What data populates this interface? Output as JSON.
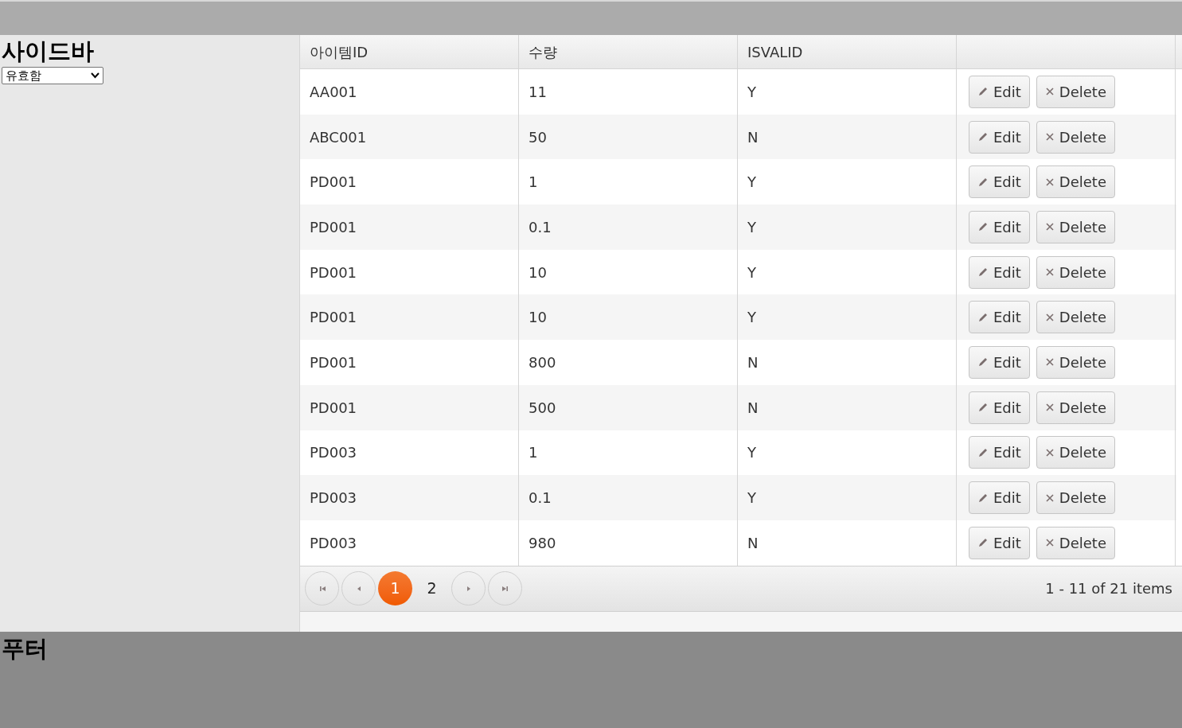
{
  "sidebar": {
    "title": "사이드바",
    "filter": {
      "value": "유효함"
    }
  },
  "grid": {
    "columns": [
      "아이템ID",
      "수량",
      "ISVALID"
    ],
    "rows": [
      {
        "cells": [
          "AA001",
          "11",
          "Y"
        ],
        "actions": [
          {
            "kind": "edit",
            "label": "Edit"
          },
          {
            "kind": "delete",
            "label": "Delete"
          }
        ]
      },
      {
        "cells": [
          "ABC001",
          "50",
          "N"
        ],
        "actions": [
          {
            "kind": "edit",
            "label": "Edit"
          },
          {
            "kind": "delete",
            "label": "Delete"
          }
        ]
      },
      {
        "cells": [
          "PD001",
          "1",
          "Y"
        ],
        "actions": [
          {
            "kind": "edit",
            "label": "Edit"
          },
          {
            "kind": "delete",
            "label": "Delete"
          }
        ]
      },
      {
        "cells": [
          "PD001",
          "0.1",
          "Y"
        ],
        "actions": [
          {
            "kind": "edit",
            "label": "Edit"
          },
          {
            "kind": "delete",
            "label": "Delete"
          }
        ]
      },
      {
        "cells": [
          "PD001",
          "10",
          "Y"
        ],
        "actions": [
          {
            "kind": "edit",
            "label": "Edit"
          },
          {
            "kind": "delete",
            "label": "Delete"
          }
        ]
      },
      {
        "cells": [
          "PD001",
          "10",
          "Y"
        ],
        "actions": [
          {
            "kind": "edit",
            "label": "Edit"
          },
          {
            "kind": "delete",
            "label": "Delete"
          }
        ]
      },
      {
        "cells": [
          "PD001",
          "800",
          "N"
        ],
        "actions": [
          {
            "kind": "edit",
            "label": "Edit"
          },
          {
            "kind": "delete",
            "label": "Delete"
          }
        ]
      },
      {
        "cells": [
          "PD001",
          "500",
          "N"
        ],
        "actions": [
          {
            "kind": "edit",
            "label": "Edit"
          },
          {
            "kind": "delete",
            "label": "Delete"
          }
        ]
      },
      {
        "cells": [
          "PD003",
          "1",
          "Y"
        ],
        "actions": [
          {
            "kind": "edit",
            "label": "Edit"
          },
          {
            "kind": "delete",
            "label": "Delete"
          }
        ]
      },
      {
        "cells": [
          "PD003",
          "0.1",
          "Y"
        ],
        "actions": [
          {
            "kind": "edit",
            "label": "Edit"
          },
          {
            "kind": "delete",
            "label": "Delete"
          }
        ]
      },
      {
        "cells": [
          "PD003",
          "980",
          "N"
        ],
        "actions": [
          {
            "kind": "edit",
            "label": "Edit"
          },
          {
            "kind": "delete",
            "label": "Delete"
          }
        ]
      }
    ],
    "pager": {
      "pages": [
        {
          "label": "1",
          "selected": true
        },
        {
          "label": "2",
          "selected": false
        }
      ],
      "info": "1 - 11 of 21 items"
    }
  },
  "footer": {
    "title": "푸터"
  }
}
